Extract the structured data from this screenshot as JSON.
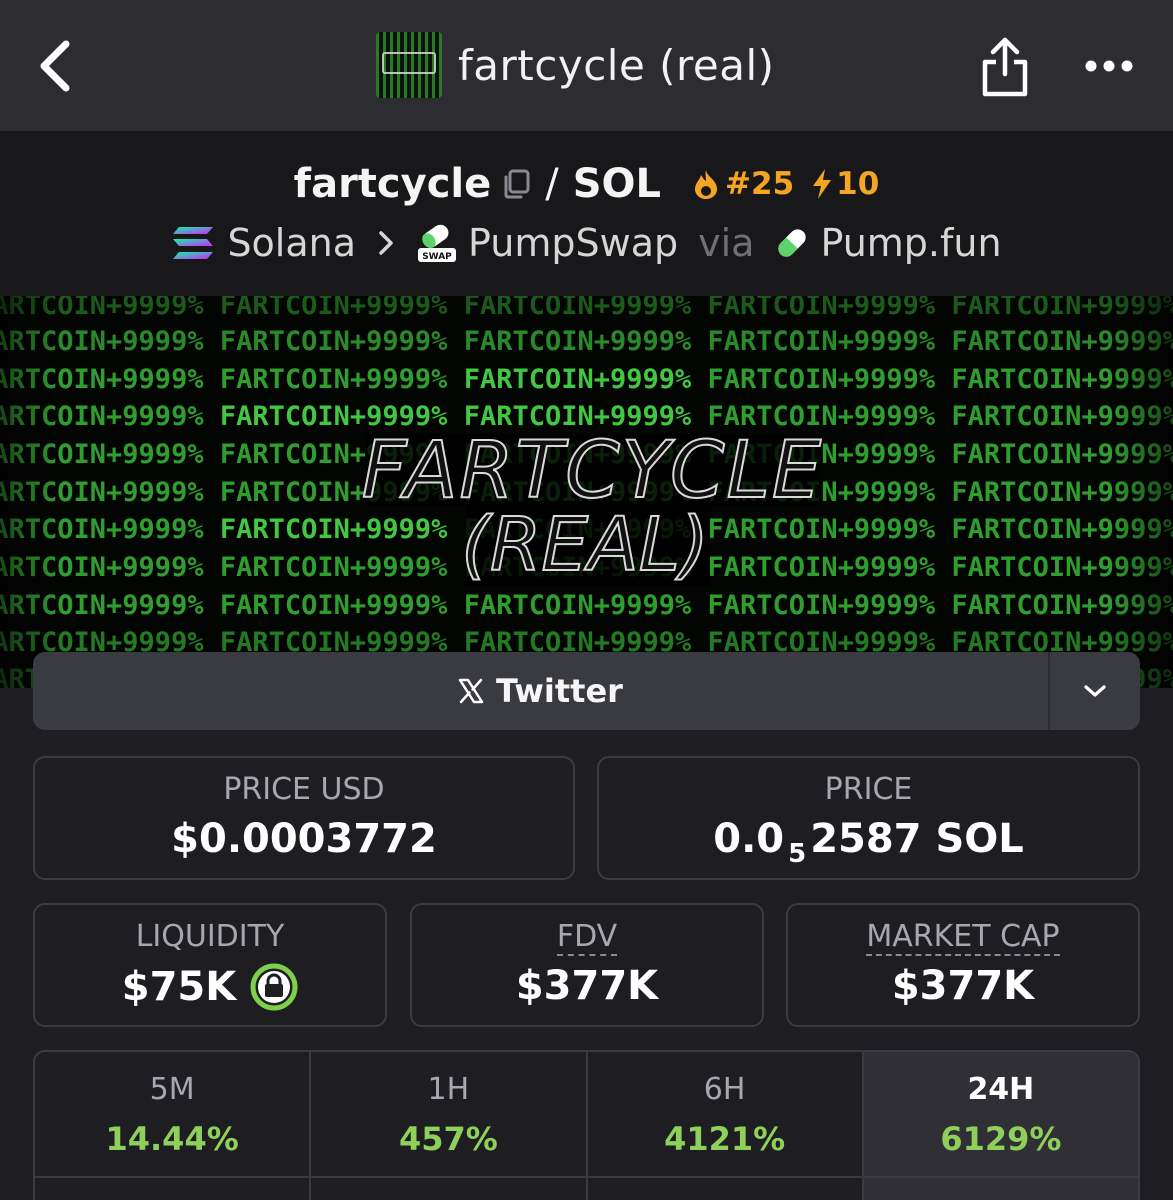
{
  "header": {
    "title": "fartcycle (real)",
    "thumb_text": "FARTCYCLE (REAL)"
  },
  "pair": {
    "base": "fartcycle",
    "separator": "/",
    "quote": "SOL",
    "trending_rank": "#25",
    "boosts": "10"
  },
  "route": {
    "chain": "Solana",
    "dex": "PumpSwap",
    "dex_badge": "SWAP",
    "via": "via",
    "launchpad": "Pump.fun"
  },
  "banner": {
    "repeat_text": "FARTCOIN+9999%",
    "logo_line1": "FARTCYCLE",
    "logo_line2": "(REAL)"
  },
  "social": {
    "label": "Twitter"
  },
  "stats": {
    "price_usd_label": "PRICE USD",
    "price_usd_value": "$0.0003772",
    "price_label": "PRICE",
    "price_prefix": "0.0",
    "price_subscript": "5",
    "price_suffix": "2587 SOL",
    "liquidity_label": "LIQUIDITY",
    "liquidity_value": "$75K",
    "fdv_label": "FDV",
    "fdv_value": "$377K",
    "mcap_label": "MARKET CAP",
    "mcap_value": "$377K"
  },
  "changes": [
    {
      "label": "5M",
      "value": "14.44%"
    },
    {
      "label": "1H",
      "value": "457%"
    },
    {
      "label": "6H",
      "value": "4121%"
    },
    {
      "label": "24H",
      "value": "6129%",
      "active": true
    }
  ],
  "colors": {
    "positive": "#8fd05a",
    "accent_orange": "#f5a524",
    "banner_green": "#35c43a",
    "lock_green": "#7fcf4a"
  }
}
